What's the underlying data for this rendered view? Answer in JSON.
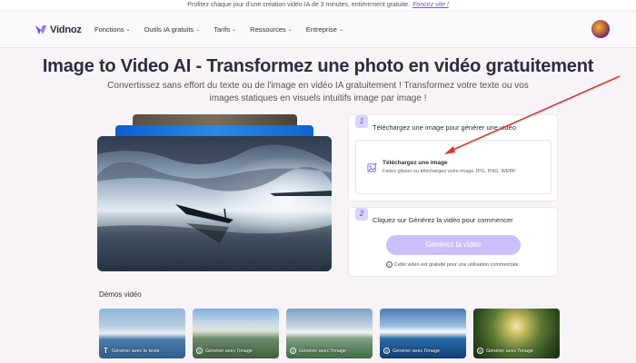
{
  "promo": {
    "text": "Profitez chaque jour d'une création vidéo IA de 3 minutes, entièrement gratuite.",
    "link": "Foncez vite !"
  },
  "nav": {
    "brand": "Vidnoz",
    "items": [
      {
        "label": "Fonctions"
      },
      {
        "label": "Outils IA gratuits"
      },
      {
        "label": "Tarifs"
      },
      {
        "label": "Ressources"
      },
      {
        "label": "Entreprise"
      }
    ]
  },
  "hero": {
    "title": "Image to Video AI - Transformez une photo en vidéo gratuitement",
    "subtitle": "Convertissez sans effort du texte ou de l'image en vidéo IA gratuitement ! Transformez votre texte ou vos images statiques en visuels intuitifs image par image !"
  },
  "step1": {
    "number": "1",
    "title": "Téléchargez une image pour générer une vidéo",
    "upload_title": "Téléchargez une image",
    "upload_hint": "Faites glisser ou téléchargez votre image JPG, PNG, WEBP"
  },
  "step2": {
    "number": "2",
    "title": "Cliquez sur Générez la vidéo pour commencer",
    "button": "Générez la vidéo",
    "note": "Cette vidéo est gratuite pour une utilisation commerciale."
  },
  "demos": {
    "label": "Démos vidéo",
    "items": [
      {
        "label": "Générer avec le texte"
      },
      {
        "label": "Générer avec l'image"
      },
      {
        "label": "Générer avec l'image"
      },
      {
        "label": "Générer avec l'image"
      },
      {
        "label": "Générer avec l'image"
      }
    ]
  },
  "colors": {
    "accent": "#6b4ff0",
    "button_disabled": "#ccc0fa",
    "arrow": "#e0332b"
  }
}
